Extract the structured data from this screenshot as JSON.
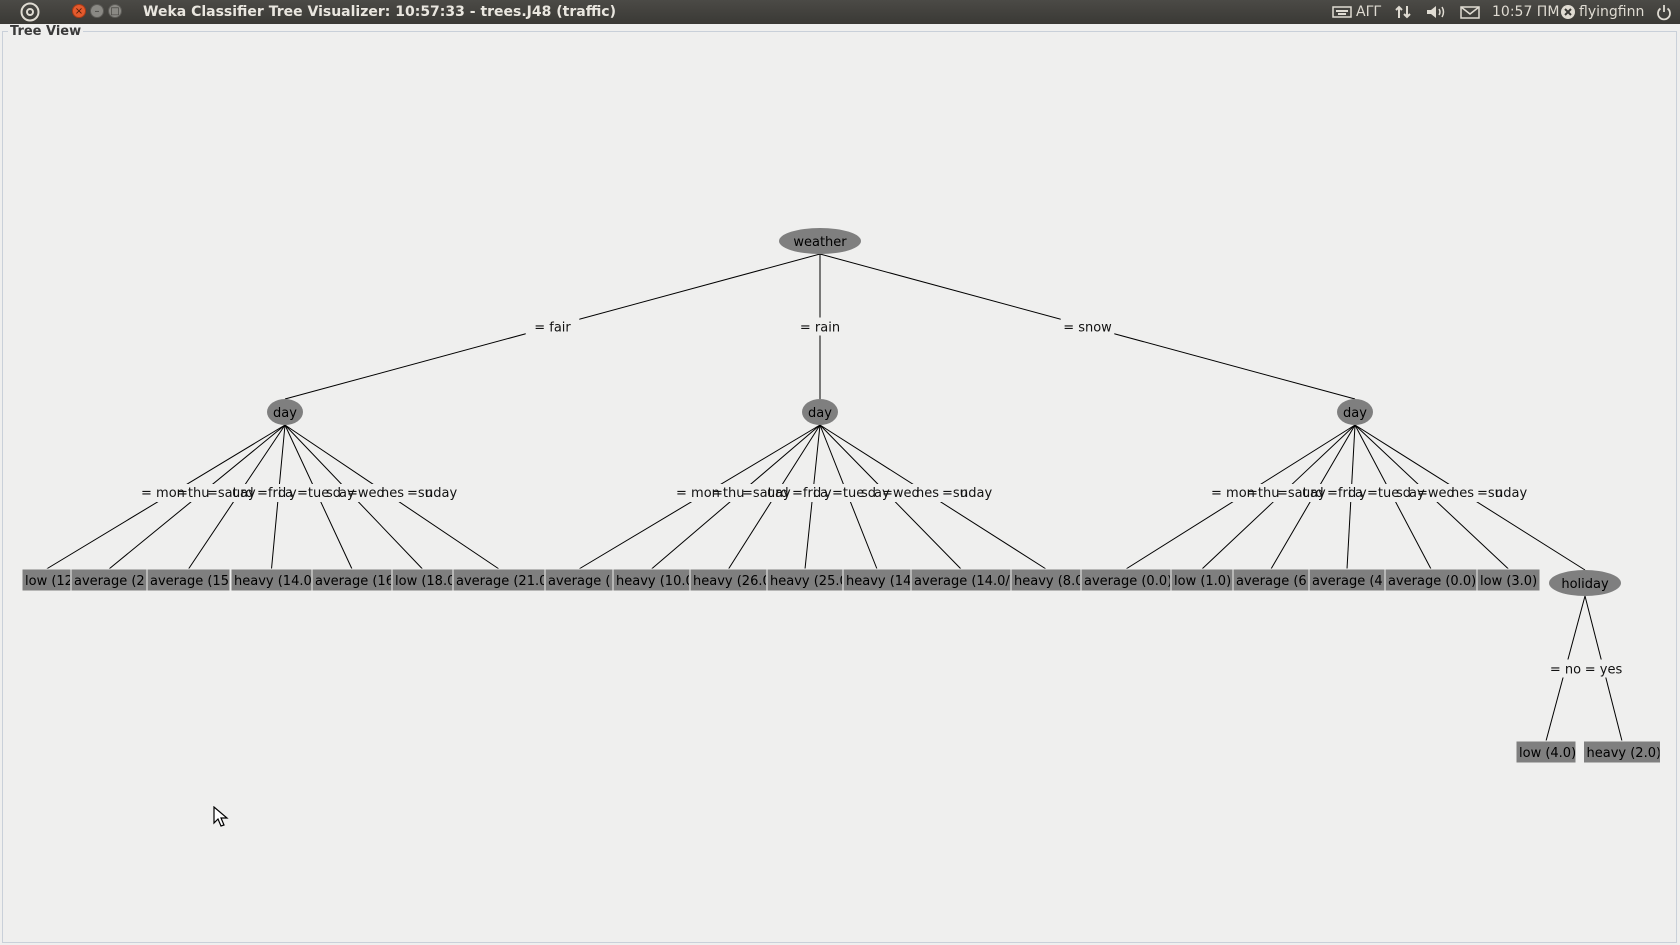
{
  "menubar": {
    "title": "Weka Classifier Tree Visualizer: 10:57:33 - trees.J48 (traffic)",
    "keyboard_layout": "ΑΓΓ",
    "clock": "10:57 ΠΜ",
    "user": "flyingfinn",
    "icons": [
      "ubuntu-logo-icon",
      "keyboard-icon",
      "network-icon",
      "volume-icon",
      "mail-icon",
      "user-icon",
      "power-icon"
    ]
  },
  "panel": {
    "title": "Tree View"
  },
  "tree": {
    "node_color": "#7f7f7f",
    "line_color": "#000000",
    "nodes": [
      {
        "text": "weather",
        "shape": "oval"
      },
      {
        "text": "day",
        "shape": "oval"
      },
      {
        "text": "day",
        "shape": "oval"
      },
      {
        "text": "day",
        "shape": "oval"
      },
      {
        "text": "low (12",
        "shape": "leaf"
      },
      {
        "text": "average (2",
        "shape": "leaf"
      },
      {
        "text": "average (15.",
        "shape": "leaf"
      },
      {
        "text": "heavy (14.0/",
        "shape": "leaf"
      },
      {
        "text": "average (16",
        "shape": "leaf"
      },
      {
        "text": "low (18.0",
        "shape": "leaf"
      },
      {
        "text": "average (21.0",
        "shape": "leaf"
      },
      {
        "text": "average (",
        "shape": "leaf"
      },
      {
        "text": "heavy (10.0",
        "shape": "leaf"
      },
      {
        "text": "heavy (26.0",
        "shape": "leaf"
      },
      {
        "text": "heavy (25.0",
        "shape": "leaf"
      },
      {
        "text": "heavy (14.",
        "shape": "leaf"
      },
      {
        "text": "average (14.0/",
        "shape": "leaf"
      },
      {
        "text": "heavy (8.0",
        "shape": "leaf"
      },
      {
        "text": "average (0.0)",
        "shape": "leaf"
      },
      {
        "text": "low (1.0)",
        "shape": "leaf"
      },
      {
        "text": "average (6.",
        "shape": "leaf"
      },
      {
        "text": "average (4.",
        "shape": "leaf"
      },
      {
        "text": "average (0.0)",
        "shape": "leaf"
      },
      {
        "text": "low (3.0)",
        "shape": "leaf"
      },
      {
        "text": "holiday",
        "shape": "oval"
      },
      {
        "text": "low (4.0)",
        "shape": "leaf"
      },
      {
        "text": "heavy (2.0)",
        "shape": "leaf"
      }
    ],
    "edges": [
      {
        "from": 0,
        "to": 1,
        "label": "= fair"
      },
      {
        "from": 0,
        "to": 2,
        "label": "= rain"
      },
      {
        "from": 0,
        "to": 3,
        "label": "= snow"
      },
      {
        "from": 1,
        "to": 4,
        "label": ""
      },
      {
        "from": 1,
        "to": 5,
        "label": ""
      },
      {
        "from": 1,
        "to": 6,
        "label": ""
      },
      {
        "from": 1,
        "to": 7,
        "label": ""
      },
      {
        "from": 1,
        "to": 8,
        "label": ""
      },
      {
        "from": 1,
        "to": 9,
        "label": ""
      },
      {
        "from": 1,
        "to": 10,
        "label": ""
      },
      {
        "from": 2,
        "to": 11,
        "label": ""
      },
      {
        "from": 2,
        "to": 12,
        "label": ""
      },
      {
        "from": 2,
        "to": 13,
        "label": ""
      },
      {
        "from": 2,
        "to": 14,
        "label": ""
      },
      {
        "from": 2,
        "to": 15,
        "label": ""
      },
      {
        "from": 2,
        "to": 16,
        "label": ""
      },
      {
        "from": 2,
        "to": 17,
        "label": ""
      },
      {
        "from": 3,
        "to": 18,
        "label": ""
      },
      {
        "from": 3,
        "to": 19,
        "label": ""
      },
      {
        "from": 3,
        "to": 20,
        "label": ""
      },
      {
        "from": 3,
        "to": 21,
        "label": ""
      },
      {
        "from": 3,
        "to": 22,
        "label": ""
      },
      {
        "from": 3,
        "to": 23,
        "label": ""
      },
      {
        "from": 3,
        "to": 24,
        "label": ""
      },
      {
        "from": 24,
        "to": 25,
        "label": "= no"
      },
      {
        "from": 24,
        "to": 26,
        "label": "= yes"
      }
    ],
    "day_edge_labels_overlap": [
      "= mon",
      "=thu",
      "=sat",
      "urd",
      "ay",
      "=fri",
      "d",
      "a",
      "y",
      "=tue",
      "sd",
      "ay",
      "=wed",
      "nes",
      "=su",
      "nday"
    ],
    "day_edge_labels_fragments": [
      "= monday",
      "= thursday",
      "= saturday",
      "= friday",
      "= tuesday",
      "= wednesday",
      "= sunday"
    ]
  }
}
